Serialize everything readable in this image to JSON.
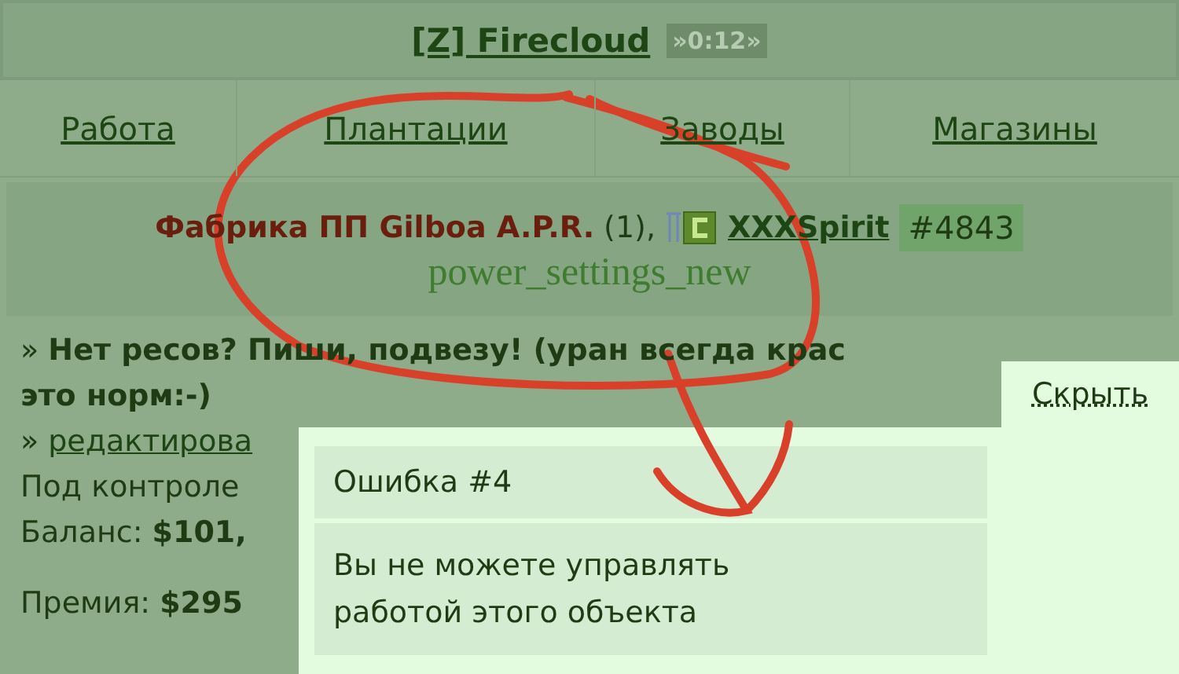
{
  "header": {
    "title": "[Z] Firecloud",
    "timer": "»0:12»"
  },
  "nav": [
    {
      "label": "Работа"
    },
    {
      "label": "Плантации"
    },
    {
      "label": "Заводы"
    },
    {
      "label": "Магазины"
    }
  ],
  "factory": {
    "name": "Фабрика ПП Gilboa A.P.R.",
    "count": "(1),",
    "owner": "XXXSpirit",
    "id": "#4843",
    "icon_text": "power_settings_new"
  },
  "notice": {
    "line_1": "» **Нет ресов? Пиши, подвезу! (уран всегда крас**",
    "line_2": "это норм:-)"
  },
  "edit_link": {
    "prefix": "»",
    "label": "редактирова"
  },
  "control": "Под контроле",
  "balance": {
    "label": "Баланс:",
    "value": "$101,"
  },
  "bonus": {
    "label": "Премия:",
    "value": "$295"
  },
  "popup": {
    "hide": "Скрыть",
    "title": "Ошибка #4",
    "message": "Вы не можете управлять работой этого объекта"
  }
}
